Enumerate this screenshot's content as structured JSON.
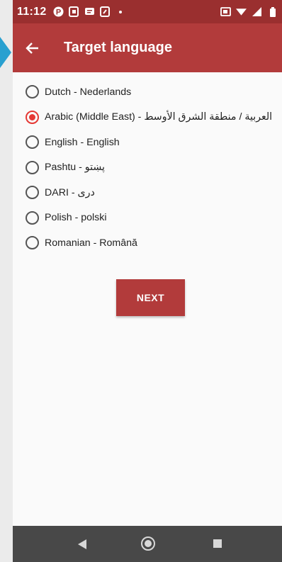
{
  "status_bar": {
    "time": "11:12",
    "left_icons": [
      "pinterest-icon",
      "app-icon",
      "message-icon",
      "app-icon",
      "dot-icon"
    ],
    "right_icons": [
      "cast-icon",
      "wifi-icon",
      "signal-icon",
      "battery-icon"
    ]
  },
  "app_bar": {
    "title": "Target language",
    "background": "#b23b3b",
    "status_background": "#9a2f2f"
  },
  "languages": [
    {
      "label": "Dutch - Nederlands",
      "selected": false
    },
    {
      "label": "Arabic (Middle East) - العربية / منطقة الشرق الأوسط",
      "selected": true
    },
    {
      "label": "English - English",
      "selected": false
    },
    {
      "label": "Pashtu - پښتو",
      "selected": false
    },
    {
      "label": "DARI - دری",
      "selected": false
    },
    {
      "label": "Polish - polski",
      "selected": false
    },
    {
      "label": "Romanian - Română",
      "selected": false
    }
  ],
  "next_button": {
    "label": "NEXT"
  },
  "nav_bar": {
    "buttons": [
      "back-icon",
      "home-icon",
      "recents-icon"
    ]
  }
}
